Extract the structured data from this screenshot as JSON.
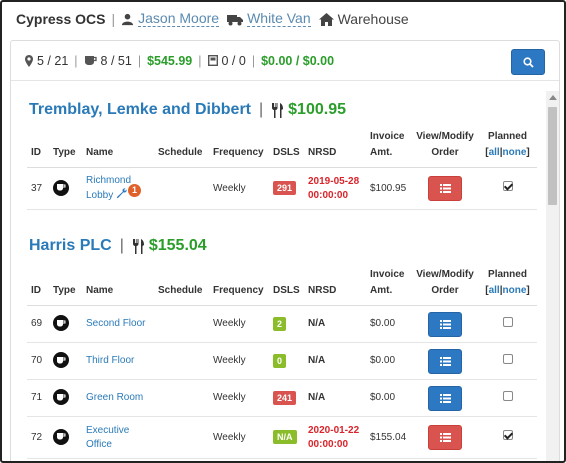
{
  "header": {
    "app_title": "Cypress OCS",
    "user_name": "Jason Moore",
    "vehicle_name": "White Van",
    "location_name": "Warehouse"
  },
  "stats": {
    "locations": "5 / 21",
    "machines": "8 / 51",
    "amount": "$545.99",
    "boxes": "0 / 0",
    "totals": "$0.00 / $0.00"
  },
  "columns": {
    "id": "ID",
    "type": "Type",
    "name": "Name",
    "schedule": "Schedule",
    "frequency": "Frequency",
    "dsls": "DSLS",
    "nrsd": "NRSD",
    "invoice_line1": "Invoice",
    "invoice_line2": "Amt.",
    "view_line1": "View/Modify",
    "view_line2": "Order",
    "planned": "Planned",
    "all_link": "all",
    "link_sep": "|",
    "none_link": "none"
  },
  "customers": [
    {
      "name": "Tremblay, Lemke and Dibbert",
      "amount": "$100.95",
      "rows": [
        {
          "id": "37",
          "name_line1": "Richmond",
          "name_line2": "Lobby",
          "alert_count": "1",
          "frequency": "Weekly",
          "dsls": "291",
          "dsls_color": "red",
          "nrsd_line1": "2019-05-28",
          "nrsd_line2": "00:00:00",
          "nrsd_red": true,
          "invoice": "$100.95",
          "order_btn_color": "red",
          "planned": true
        }
      ]
    },
    {
      "name": "Harris PLC",
      "amount": "$155.04",
      "rows": [
        {
          "id": "69",
          "name_line1": "Second Floor",
          "frequency": "Weekly",
          "dsls": "2",
          "dsls_color": "green",
          "nrsd_line1": "N/A",
          "invoice": "$0.00",
          "order_btn_color": "blue",
          "planned": false
        },
        {
          "id": "70",
          "name_line1": "Third Floor",
          "frequency": "Weekly",
          "dsls": "0",
          "dsls_color": "green",
          "nrsd_line1": "N/A",
          "invoice": "$0.00",
          "order_btn_color": "blue",
          "planned": false
        },
        {
          "id": "71",
          "name_line1": "Green Room",
          "frequency": "Weekly",
          "dsls": "241",
          "dsls_color": "red",
          "nrsd_line1": "N/A",
          "invoice": "$0.00",
          "order_btn_color": "blue",
          "planned": false
        },
        {
          "id": "72",
          "name_line1": "Executive",
          "name_line2": "Office",
          "frequency": "Weekly",
          "dsls": "N/A",
          "dsls_color": "green",
          "nrsd_line1": "2020-01-22",
          "nrsd_line2": "00:00:00",
          "nrsd_red": true,
          "invoice": "$155.04",
          "order_btn_color": "red",
          "planned": true
        }
      ]
    }
  ],
  "colors": {
    "accent_blue": "#2d78c2",
    "danger_red": "#d9534f",
    "money_green": "#2a9d2a",
    "badge_green": "#8bbd2a"
  }
}
